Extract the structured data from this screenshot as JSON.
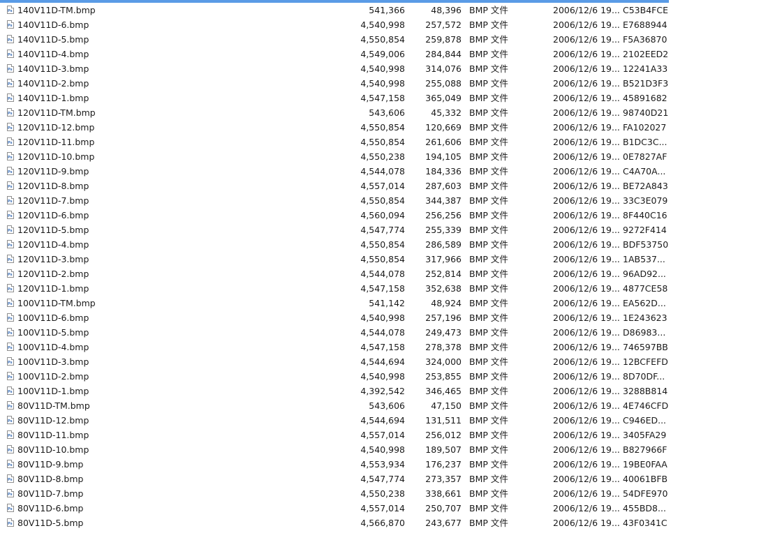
{
  "colors": {
    "selection_bar": "#5a9be6",
    "text": "#1a1a1a",
    "background": "#ffffff"
  },
  "file_icon": "photoshop-bmp-file-icon",
  "icon_label": "Ps",
  "files": [
    {
      "name": "140V11D-TM.bmp",
      "size": "541,366",
      "packed": "48,396",
      "type": "BMP 文件",
      "modified": "2006/12/6 19...",
      "crc": "C53B4FCE"
    },
    {
      "name": "140V11D-6.bmp",
      "size": "4,540,998",
      "packed": "257,572",
      "type": "BMP 文件",
      "modified": "2006/12/6 19...",
      "crc": "E7688944"
    },
    {
      "name": "140V11D-5.bmp",
      "size": "4,550,854",
      "packed": "259,878",
      "type": "BMP 文件",
      "modified": "2006/12/6 19...",
      "crc": "F5A36870"
    },
    {
      "name": "140V11D-4.bmp",
      "size": "4,549,006",
      "packed": "284,844",
      "type": "BMP 文件",
      "modified": "2006/12/6 19...",
      "crc": "2102EED2"
    },
    {
      "name": "140V11D-3.bmp",
      "size": "4,540,998",
      "packed": "314,076",
      "type": "BMP 文件",
      "modified": "2006/12/6 19...",
      "crc": "12241A33"
    },
    {
      "name": "140V11D-2.bmp",
      "size": "4,540,998",
      "packed": "255,088",
      "type": "BMP 文件",
      "modified": "2006/12/6 19...",
      "crc": "B521D3F3"
    },
    {
      "name": "140V11D-1.bmp",
      "size": "4,547,158",
      "packed": "365,049",
      "type": "BMP 文件",
      "modified": "2006/12/6 19...",
      "crc": "45891682"
    },
    {
      "name": "120V11D-TM.bmp",
      "size": "543,606",
      "packed": "45,332",
      "type": "BMP 文件",
      "modified": "2006/12/6 19...",
      "crc": "98740D21"
    },
    {
      "name": "120V11D-12.bmp",
      "size": "4,550,854",
      "packed": "120,669",
      "type": "BMP 文件",
      "modified": "2006/12/6 19...",
      "crc": "FA102027"
    },
    {
      "name": "120V11D-11.bmp",
      "size": "4,550,854",
      "packed": "261,606",
      "type": "BMP 文件",
      "modified": "2006/12/6 19...",
      "crc": "B1DC3C..."
    },
    {
      "name": "120V11D-10.bmp",
      "size": "4,550,238",
      "packed": "194,105",
      "type": "BMP 文件",
      "modified": "2006/12/6 19...",
      "crc": "0E7827AF"
    },
    {
      "name": "120V11D-9.bmp",
      "size": "4,544,078",
      "packed": "184,336",
      "type": "BMP 文件",
      "modified": "2006/12/6 19...",
      "crc": "C4A70A..."
    },
    {
      "name": "120V11D-8.bmp",
      "size": "4,557,014",
      "packed": "287,603",
      "type": "BMP 文件",
      "modified": "2006/12/6 19...",
      "crc": "BE72A843"
    },
    {
      "name": "120V11D-7.bmp",
      "size": "4,550,854",
      "packed": "344,387",
      "type": "BMP 文件",
      "modified": "2006/12/6 19...",
      "crc": "33C3E079"
    },
    {
      "name": "120V11D-6.bmp",
      "size": "4,560,094",
      "packed": "256,256",
      "type": "BMP 文件",
      "modified": "2006/12/6 19...",
      "crc": "8F440C16"
    },
    {
      "name": "120V11D-5.bmp",
      "size": "4,547,774",
      "packed": "255,339",
      "type": "BMP 文件",
      "modified": "2006/12/6 19...",
      "crc": "9272F414"
    },
    {
      "name": "120V11D-4.bmp",
      "size": "4,550,854",
      "packed": "286,589",
      "type": "BMP 文件",
      "modified": "2006/12/6 19...",
      "crc": "BDF53750"
    },
    {
      "name": "120V11D-3.bmp",
      "size": "4,550,854",
      "packed": "317,966",
      "type": "BMP 文件",
      "modified": "2006/12/6 19...",
      "crc": "1AB537..."
    },
    {
      "name": "120V11D-2.bmp",
      "size": "4,544,078",
      "packed": "252,814",
      "type": "BMP 文件",
      "modified": "2006/12/6 19...",
      "crc": "96AD92..."
    },
    {
      "name": "120V11D-1.bmp",
      "size": "4,547,158",
      "packed": "352,638",
      "type": "BMP 文件",
      "modified": "2006/12/6 19...",
      "crc": "4877CE58"
    },
    {
      "name": "100V11D-TM.bmp",
      "size": "541,142",
      "packed": "48,924",
      "type": "BMP 文件",
      "modified": "2006/12/6 19...",
      "crc": "EA562D..."
    },
    {
      "name": "100V11D-6.bmp",
      "size": "4,540,998",
      "packed": "257,196",
      "type": "BMP 文件",
      "modified": "2006/12/6 19...",
      "crc": "1E243623"
    },
    {
      "name": "100V11D-5.bmp",
      "size": "4,544,078",
      "packed": "249,473",
      "type": "BMP 文件",
      "modified": "2006/12/6 19...",
      "crc": "D86983..."
    },
    {
      "name": "100V11D-4.bmp",
      "size": "4,547,158",
      "packed": "278,378",
      "type": "BMP 文件",
      "modified": "2006/12/6 19...",
      "crc": "746597BB"
    },
    {
      "name": "100V11D-3.bmp",
      "size": "4,544,694",
      "packed": "324,000",
      "type": "BMP 文件",
      "modified": "2006/12/6 19...",
      "crc": "12BCFEFD"
    },
    {
      "name": "100V11D-2.bmp",
      "size": "4,540,998",
      "packed": "253,855",
      "type": "BMP 文件",
      "modified": "2006/12/6 19...",
      "crc": "8D70DF..."
    },
    {
      "name": "100V11D-1.bmp",
      "size": "4,392,542",
      "packed": "346,465",
      "type": "BMP 文件",
      "modified": "2006/12/6 19...",
      "crc": "3288B814"
    },
    {
      "name": "80V11D-TM.bmp",
      "size": "543,606",
      "packed": "47,150",
      "type": "BMP 文件",
      "modified": "2006/12/6 19...",
      "crc": "4E746CFD"
    },
    {
      "name": "80V11D-12.bmp",
      "size": "4,544,694",
      "packed": "131,511",
      "type": "BMP 文件",
      "modified": "2006/12/6 19...",
      "crc": "C946ED..."
    },
    {
      "name": "80V11D-11.bmp",
      "size": "4,557,014",
      "packed": "256,012",
      "type": "BMP 文件",
      "modified": "2006/12/6 19...",
      "crc": "3405FA29"
    },
    {
      "name": "80V11D-10.bmp",
      "size": "4,540,998",
      "packed": "189,507",
      "type": "BMP 文件",
      "modified": "2006/12/6 19...",
      "crc": "B827966F"
    },
    {
      "name": "80V11D-9.bmp",
      "size": "4,553,934",
      "packed": "176,237",
      "type": "BMP 文件",
      "modified": "2006/12/6 19...",
      "crc": "19BE0FAA"
    },
    {
      "name": "80V11D-8.bmp",
      "size": "4,547,774",
      "packed": "273,357",
      "type": "BMP 文件",
      "modified": "2006/12/6 19...",
      "crc": "40061BFB"
    },
    {
      "name": "80V11D-7.bmp",
      "size": "4,550,238",
      "packed": "338,661",
      "type": "BMP 文件",
      "modified": "2006/12/6 19...",
      "crc": "54DFE970"
    },
    {
      "name": "80V11D-6.bmp",
      "size": "4,557,014",
      "packed": "250,707",
      "type": "BMP 文件",
      "modified": "2006/12/6 19...",
      "crc": "455BD8..."
    },
    {
      "name": "80V11D-5.bmp",
      "size": "4,566,870",
      "packed": "243,677",
      "type": "BMP 文件",
      "modified": "2006/12/6 19...",
      "crc": "43F0341C"
    }
  ]
}
